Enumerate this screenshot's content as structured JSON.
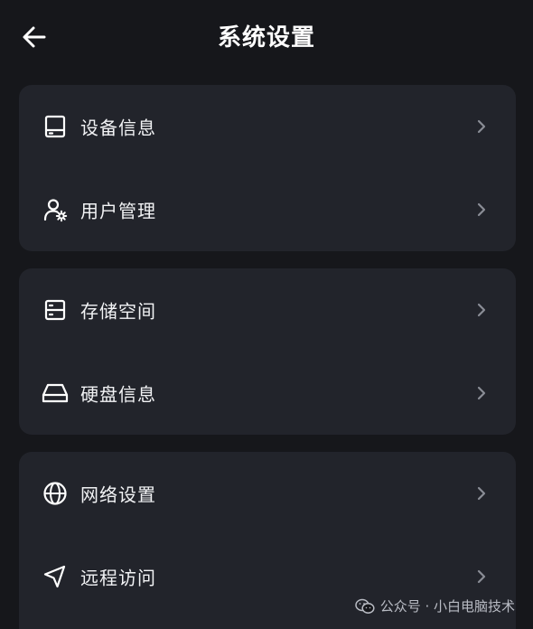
{
  "header": {
    "title": "系统设置",
    "back_icon": "arrow-left-icon"
  },
  "groups": [
    {
      "items": [
        {
          "label": "设备信息",
          "icon": "device-icon"
        },
        {
          "label": "用户管理",
          "icon": "user-settings-icon"
        }
      ]
    },
    {
      "items": [
        {
          "label": "存储空间",
          "icon": "storage-icon"
        },
        {
          "label": "硬盘信息",
          "icon": "hard-disk-icon"
        }
      ]
    },
    {
      "items": [
        {
          "label": "网络设置",
          "icon": "globe-icon"
        },
        {
          "label": "远程访问",
          "icon": "send-icon"
        }
      ]
    }
  ],
  "watermark": {
    "text": "公众号 · 小白电脑技术",
    "icon": "wechat-icon"
  },
  "colors": {
    "background": "#16171b",
    "card": "#22242b",
    "text": "#f2f3f5",
    "chevron": "#8a8d96"
  }
}
